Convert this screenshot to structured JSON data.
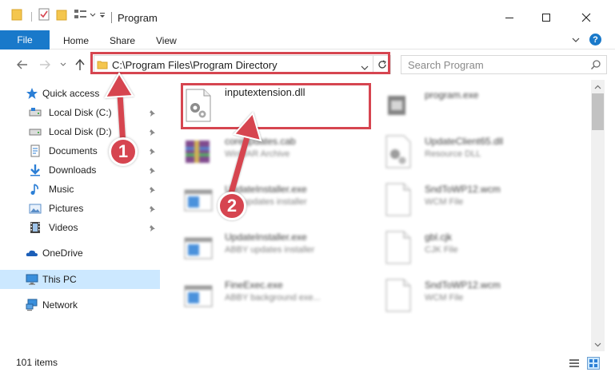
{
  "window": {
    "title": "Program"
  },
  "ribbon": {
    "tabs": [
      "File",
      "Home",
      "Share",
      "View"
    ],
    "help_label": "?"
  },
  "address": {
    "path": "C:\\Program Files\\Program Directory",
    "search_placeholder": "Search Program"
  },
  "nav": {
    "quick_access": "Quick access",
    "items": [
      {
        "label": "Local Disk (C:)",
        "icon": "drive-icon",
        "pinned": true
      },
      {
        "label": "Local Disk (D:)",
        "icon": "drive-icon",
        "pinned": true
      },
      {
        "label": "Documents",
        "icon": "documents-icon",
        "pinned": true
      },
      {
        "label": "Downloads",
        "icon": "downloads-icon",
        "pinned": true
      },
      {
        "label": "Music",
        "icon": "music-icon",
        "pinned": true
      },
      {
        "label": "Pictures",
        "icon": "pictures-icon",
        "pinned": true
      },
      {
        "label": "Videos",
        "icon": "videos-icon",
        "pinned": true
      }
    ],
    "onedrive": "OneDrive",
    "this_pc": "This PC",
    "network": "Network"
  },
  "files": [
    {
      "name": "inputextension.dll",
      "type": "",
      "icon": "dll-gear-icon",
      "highlighted": true
    },
    {
      "name": "program.exe",
      "type": "",
      "icon": "exe-icon"
    },
    {
      "name": "coreupdates.cab",
      "type": "WinRAR Archive",
      "icon": "winrar-icon"
    },
    {
      "name": "UpdateClient65.dll",
      "type": "Resource DLL",
      "icon": "dll-gear-icon"
    },
    {
      "name": "UpdateInstaller.exe",
      "type": "Sap updates installer",
      "icon": "window-icon"
    },
    {
      "name": "SndToWP12.wcm",
      "type": "WCM File",
      "icon": "blank-file-icon"
    },
    {
      "name": "UpdateInstaller.exe",
      "type": "ABBY updates installer",
      "icon": "window-icon"
    },
    {
      "name": "gbl.cjk",
      "type": "CJK File",
      "icon": "blank-file-icon"
    },
    {
      "name": "FineExec.exe",
      "type": "ABBY background exe...",
      "icon": "window-icon"
    },
    {
      "name": "SndToWP12.wcm",
      "type": "WCM File",
      "icon": "blank-file-icon"
    }
  ],
  "status": {
    "items_count": "101 items"
  },
  "annotations": {
    "badge1": "1",
    "badge2": "2",
    "color": "#d64550"
  },
  "colors": {
    "accent": "#1979ca",
    "selection": "#cce8ff"
  }
}
